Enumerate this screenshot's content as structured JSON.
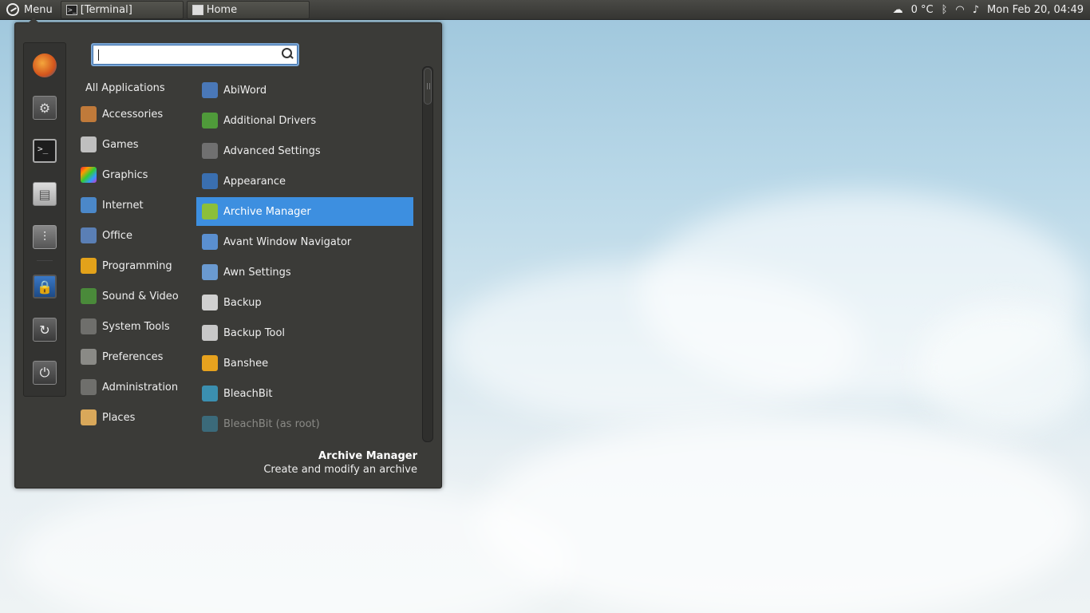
{
  "panel": {
    "menu_label": "Menu",
    "tasks": [
      {
        "label": "[Terminal]",
        "icon": "terminal-icon"
      },
      {
        "label": "Home",
        "icon": "folder-icon"
      }
    ],
    "tray": {
      "weather": "0 °C",
      "datetime": "Mon Feb 20, 04:49"
    }
  },
  "favorites": [
    {
      "name": "firefox-icon"
    },
    {
      "name": "system-settings-icon"
    },
    {
      "name": "terminal-icon"
    },
    {
      "name": "file-manager-icon"
    },
    {
      "name": "control-center-icon"
    },
    {
      "name": "lock-screen-icon"
    },
    {
      "name": "logout-icon"
    },
    {
      "name": "shutdown-icon"
    }
  ],
  "search": {
    "placeholder": "",
    "value": ""
  },
  "categories": {
    "all": "All Applications",
    "items": [
      {
        "label": "Accessories",
        "color": "#c07a3a"
      },
      {
        "label": "Games",
        "color": "#bfbfbf"
      },
      {
        "label": "Graphics",
        "color": "#c94fb0"
      },
      {
        "label": "Internet",
        "color": "#4b88c9"
      },
      {
        "label": "Office",
        "color": "#5a7fb5"
      },
      {
        "label": "Programming",
        "color": "#e3a21a"
      },
      {
        "label": "Sound & Video",
        "color": "#4a8a3a"
      },
      {
        "label": "System Tools",
        "color": "#6f6f6c"
      },
      {
        "label": "Preferences",
        "color": "#8a8a86"
      },
      {
        "label": "Administration",
        "color": "#6f6f6c"
      },
      {
        "label": "Places",
        "color": "#d9a85a"
      }
    ]
  },
  "apps": [
    {
      "label": "AbiWord",
      "color": "#4a78b8"
    },
    {
      "label": "Additional Drivers",
      "color": "#4f9a3a"
    },
    {
      "label": "Advanced Settings",
      "color": "#707070"
    },
    {
      "label": "Appearance",
      "color": "#3a6fb0"
    },
    {
      "label": "Archive Manager",
      "color": "#8cbf3a",
      "selected": true
    },
    {
      "label": "Avant Window Navigator",
      "color": "#5a8fd0"
    },
    {
      "label": "Awn Settings",
      "color": "#6a9ad0"
    },
    {
      "label": "Backup",
      "color": "#d0d0d0"
    },
    {
      "label": "Backup Tool",
      "color": "#c8c8c8"
    },
    {
      "label": "Banshee",
      "color": "#e7a21e"
    },
    {
      "label": "BleachBit",
      "color": "#3b8fb0"
    },
    {
      "label": "BleachBit (as root)",
      "color": "#3b6a7a",
      "dim": true
    }
  ],
  "description": {
    "title": "Archive Manager",
    "text": "Create and modify an archive"
  }
}
